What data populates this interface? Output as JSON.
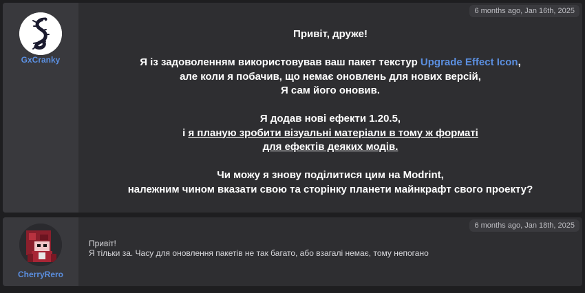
{
  "posts": [
    {
      "author": "GxCranky",
      "date": "6 months ago, Jan 16th, 2025",
      "lines": {
        "greeting": "Привіт, друже!",
        "p1_pre": "Я із задоволенням використовував ваш пакет текстур ",
        "p1_link": "Upgrade Effect Icon",
        "p1_post": ",",
        "p1_l2": "але коли я побачив, що немає оновлень для нових версій,",
        "p1_l3": "Я сам його оновив.",
        "p2_l1": "Я додав нові ефекти 1.20.5,",
        "p2_l2_pre": "і ",
        "p2_l2_u": "я планую зробити візуальні матеріали в тому ж форматі",
        "p2_l3_u": "для ефектів деяких модів.",
        "p3_l1": "Чи можу я знову поділитися цим на Modrint,",
        "p3_l2": "належним чином вказати свою та сторінку планети майнкрафт свого проекту?"
      }
    },
    {
      "author": "CherryRero",
      "date": "6 months ago, Jan 18th, 2025",
      "lines": {
        "l1": "Привіт!",
        "l2": "Я тільки за. Часу для оновлення пакетів не так багато, або взагалі немає, тому непогано"
      }
    }
  ],
  "colors": {
    "link": "#5b8fe0",
    "panel": "#2e2e31",
    "sidebar": "#39393d"
  },
  "icons": {
    "avatar1": "serpent-logo-icon",
    "avatar2": "pixel-character-icon"
  }
}
